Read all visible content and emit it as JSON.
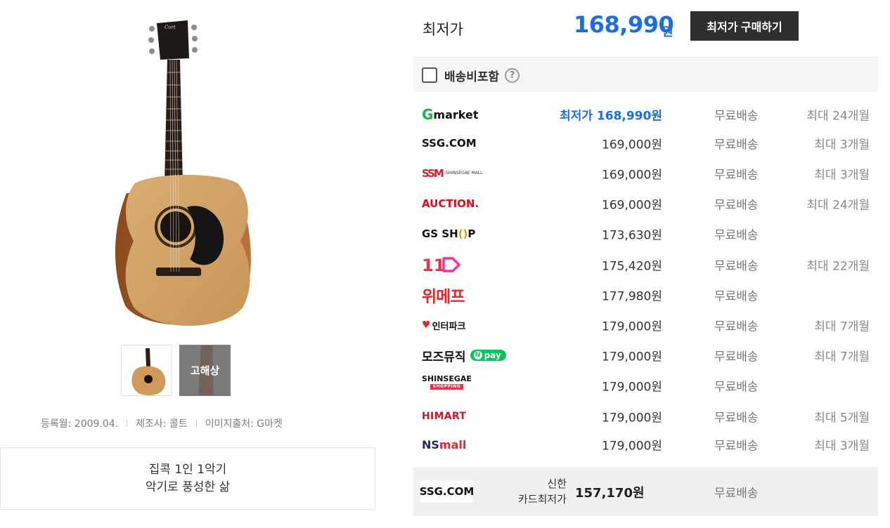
{
  "product": {
    "thumbnail_hires_label": "고해상",
    "meta": {
      "registered": "등록월: 2009.04.",
      "maker": "제조사: 콜트",
      "image_source": "이미지출처: G마켓"
    },
    "tagline": [
      "집콕 1인 1악기",
      "악기로 풍성한 삶"
    ]
  },
  "price_header": {
    "label": "최저가",
    "amount": "168,990",
    "currency": "원",
    "buy_button": "최저가 구매하기"
  },
  "shipping_filter": {
    "label": "배송비포함",
    "help_icon": "?"
  },
  "offers": [
    {
      "logo": "gmarket",
      "logo_text": [
        "G",
        "market"
      ],
      "price": "최저가 168,990원",
      "best": true,
      "shipping": "무료배송",
      "installment": "최대 24개월"
    },
    {
      "logo": "ssg",
      "logo_text": [
        "SSG.COM"
      ],
      "price": "169,000원",
      "best": false,
      "shipping": "무료배송",
      "installment": "최대 3개월"
    },
    {
      "logo": "shinsegae-mall",
      "logo_text": [
        "SSM",
        "SHINSEGAE MALL"
      ],
      "price": "169,000원",
      "best": false,
      "shipping": "무료배송",
      "installment": "최대 3개월"
    },
    {
      "logo": "auction",
      "logo_text": [
        "AUCTION."
      ],
      "price": "169,000원",
      "best": false,
      "shipping": "무료배송",
      "installment": "최대 24개월"
    },
    {
      "logo": "gsshop",
      "logo_text": [
        "GS SH",
        "()",
        "P"
      ],
      "price": "173,630원",
      "best": false,
      "shipping": "무료배송",
      "installment": ""
    },
    {
      "logo": "11st",
      "logo_text": [
        "11"
      ],
      "price": "175,420원",
      "best": false,
      "shipping": "무료배송",
      "installment": "최대 22개월"
    },
    {
      "logo": "wemakeprice",
      "logo_text": [
        "위메프"
      ],
      "price": "177,980원",
      "best": false,
      "shipping": "무료배송",
      "installment": ""
    },
    {
      "logo": "interpark",
      "logo_text": [
        "인터파크"
      ],
      "price": "179,000원",
      "best": false,
      "shipping": "무료배송",
      "installment": "최대 7개월"
    },
    {
      "logo": "mozeu-npay",
      "logo_text": [
        "모즈뮤직",
        "pay"
      ],
      "price": "179,000원",
      "best": false,
      "shipping": "무료배송",
      "installment": "최대 7개월"
    },
    {
      "logo": "shinsegae",
      "logo_text": [
        "SHINSEGAE",
        "SHOPPING"
      ],
      "price": "179,000원",
      "best": false,
      "shipping": "무료배송",
      "installment": ""
    },
    {
      "logo": "himart",
      "logo_text": [
        "HIMART"
      ],
      "price": "179,000원",
      "best": false,
      "shipping": "무료배송",
      "installment": "최대 5개월"
    },
    {
      "logo": "nsmall",
      "logo_text": [
        "NS",
        "mall"
      ],
      "price": "179,000원",
      "best": false,
      "shipping": "무료배송",
      "installment": "최대 3개월"
    }
  ],
  "card_offer": {
    "logo_text": "SSG.COM",
    "label_line1": "신한",
    "label_line2": "카드최저가",
    "price": "157,170원",
    "shipping": "무료배송"
  },
  "colors": {
    "accent_blue": "#1c6ee0",
    "button_dark": "#2f2f2f",
    "filter_bg": "#f5f5f5",
    "card_row_bg": "#eef0f2"
  }
}
